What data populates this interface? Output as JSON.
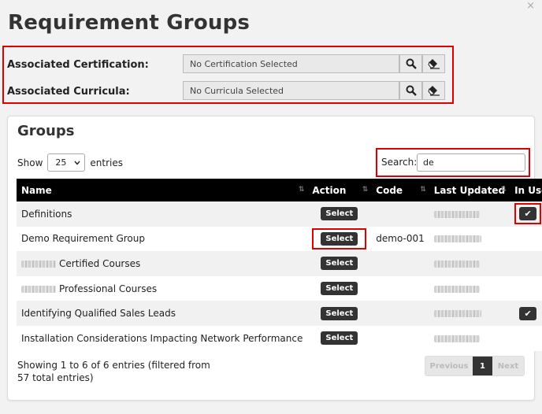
{
  "dialog": {
    "title": "Requirement Groups",
    "close_glyph": "×"
  },
  "associations": {
    "certification": {
      "label": "Associated Certification:",
      "value": "No Certification Selected"
    },
    "curricula": {
      "label": "Associated Curricula:",
      "value": "No Curricula Selected"
    }
  },
  "groups": {
    "title": "Groups",
    "show_label": "Show",
    "entries_value": "25",
    "entries_label": "entries",
    "search_label": "Search:",
    "search_value": "de",
    "columns": [
      "Name",
      "Action",
      "Code",
      "Last Updated",
      "In Use"
    ],
    "select_label": "Select",
    "rows": [
      {
        "name_prefix_redacted": false,
        "name": "Definitions",
        "code": "",
        "in_use": true
      },
      {
        "name_prefix_redacted": false,
        "name": "Demo Requirement Group",
        "code": "demo-001",
        "in_use": false
      },
      {
        "name_prefix_redacted": true,
        "name": "Certified Courses",
        "code": "",
        "in_use": false
      },
      {
        "name_prefix_redacted": true,
        "name": "Professional Courses",
        "code": "",
        "in_use": false
      },
      {
        "name_prefix_redacted": false,
        "name": "Identifying Qualified Sales Leads",
        "code": "",
        "in_use": true
      },
      {
        "name_prefix_redacted": false,
        "name": "Installation Considerations Impacting Network Performance",
        "code": "",
        "in_use": false
      }
    ],
    "info": "Showing 1 to 6 of 6 entries (filtered from 57 total entries)",
    "pager": {
      "previous": "Previous",
      "current": "1",
      "next": "Next"
    }
  },
  "colors": {
    "highlight": "#e00000",
    "header_bg": "#000000",
    "button_bg": "#333333"
  }
}
